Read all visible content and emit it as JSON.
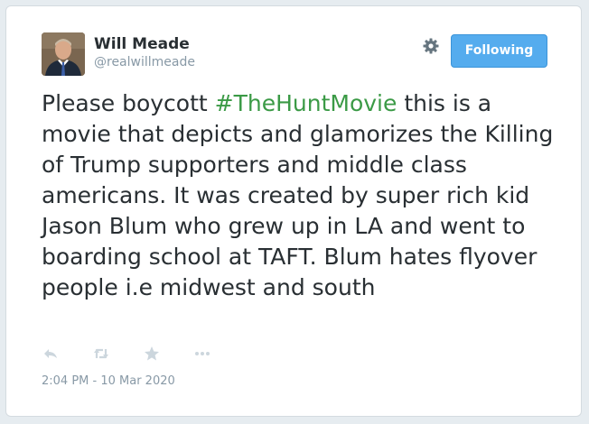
{
  "user": {
    "display_name": "Will Meade",
    "handle": "@realwillmeade",
    "avatar_icon": "user-avatar-photo"
  },
  "header": {
    "settings_icon": "gear-icon",
    "follow_button_label": "Following"
  },
  "tweet": {
    "text_before_hashtag": "Please boycott ",
    "hashtag": "#TheHuntMovie",
    "text_after_hashtag": " this is a movie that depicts and glamorizes the Killing of Trump supporters and middle class americans. It was created by super rich kid Jason Blum who grew up in LA and went to boarding school at TAFT. Blum hates flyover people i.e midwest and south",
    "timestamp": "2:04 PM - 10 Mar 2020"
  },
  "actions": [
    {
      "name": "reply-icon"
    },
    {
      "name": "retweet-icon"
    },
    {
      "name": "favorite-star-icon"
    },
    {
      "name": "more-options-icon"
    }
  ],
  "colors": {
    "hashtag": "#3b9a46",
    "follow_button": "#55acee",
    "secondary_text": "#8899a6",
    "action_icons": "#ccd6dd"
  }
}
